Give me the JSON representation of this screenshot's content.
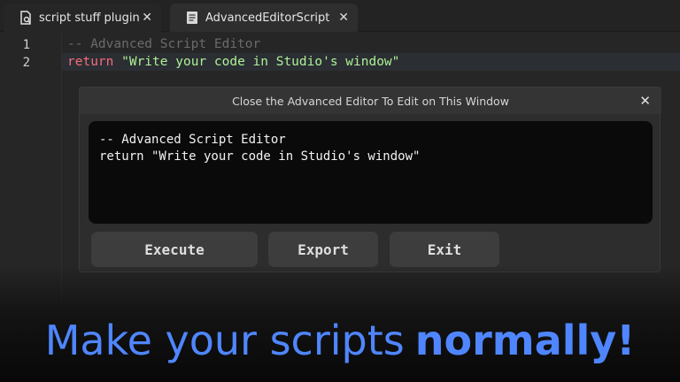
{
  "tabs": [
    {
      "label": "script stuff plugin",
      "icon": "script-icon",
      "close": "✕"
    },
    {
      "label": "AdvancedEditorScript",
      "icon": "document-icon",
      "close": "✕"
    }
  ],
  "editor": {
    "lines": [
      {
        "num": "1",
        "comment": "-- Advanced Script Editor"
      },
      {
        "num": "2",
        "keyword": "return",
        "string": " \"Write your code in Studio's window\""
      }
    ]
  },
  "dialog": {
    "title": "Close the Advanced Editor To Edit on This Window",
    "close": "✕",
    "preview_text": "-- Advanced Script Editor\nreturn \"Write your code in Studio's window\"",
    "buttons": {
      "execute": "Execute",
      "export": "Export",
      "exit": "Exit"
    }
  },
  "caption": {
    "regular": "Make your scripts",
    "bold": "normally!",
    "color": "#4f86ff"
  },
  "colors": {
    "keyword": "#f86d7c",
    "string": "#adf195",
    "comment": "#6b6b6b"
  }
}
